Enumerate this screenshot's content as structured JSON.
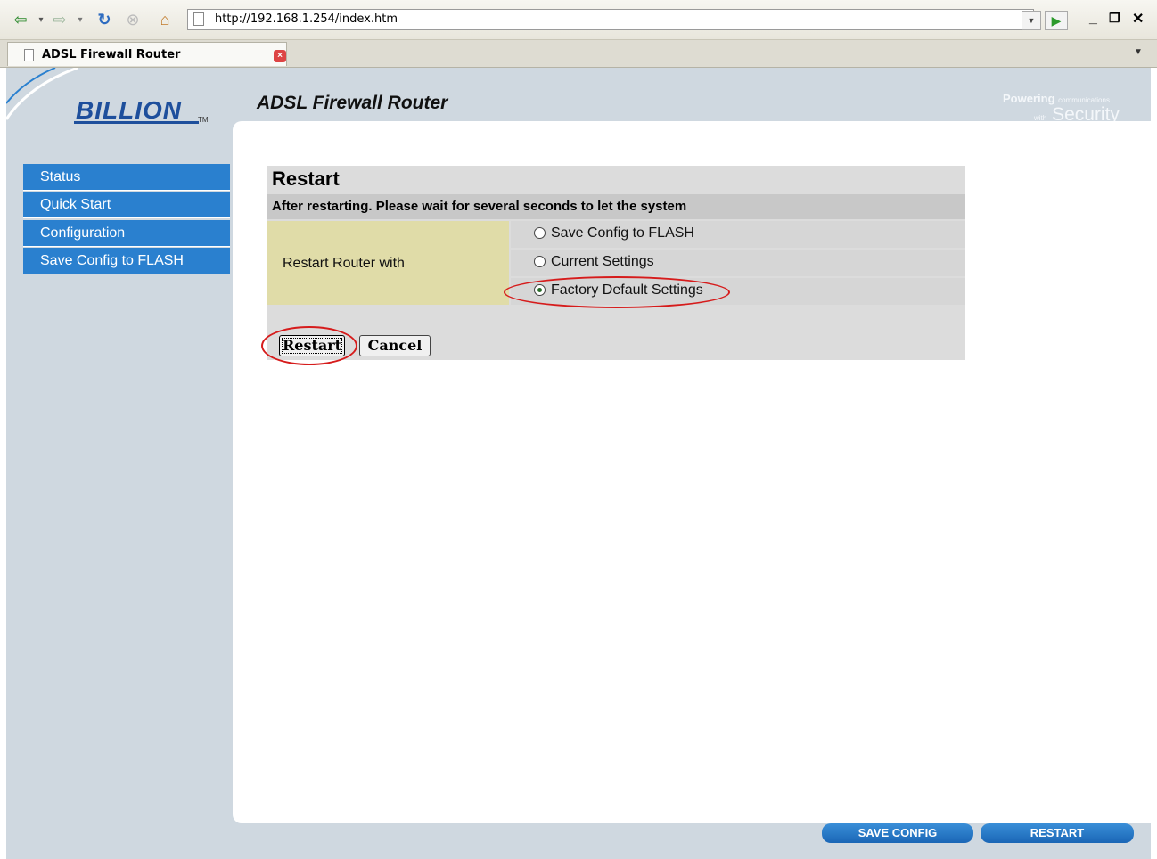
{
  "browser": {
    "url": "http://192.168.1.254/index.htm",
    "tab_title": "ADSL Firewall Router",
    "back_icon": "back-arrow-icon",
    "forward_icon": "forward-arrow-icon",
    "reload_icon": "reload-icon",
    "stop_icon": "stop-icon",
    "home_icon": "home-icon"
  },
  "header": {
    "logo": "BILLION",
    "logo_tm": "TM",
    "title": "ADSL Firewall Router",
    "slogan_big": "Powering",
    "slogan_small": "communications",
    "slogan_with": "with",
    "slogan_security": "Security"
  },
  "sidebar": {
    "items": [
      {
        "label": "Status"
      },
      {
        "label": "Quick Start"
      },
      {
        "label": "Configuration"
      },
      {
        "label": "Save Config to FLASH"
      }
    ]
  },
  "restart_panel": {
    "title": "Restart",
    "message": "After restarting. Please wait for several seconds to let the system",
    "row_label": "Restart Router with",
    "options": [
      {
        "label": "Save Config to FLASH",
        "checked": false
      },
      {
        "label": "Current Settings",
        "checked": false
      },
      {
        "label": "Factory Default Settings",
        "checked": true
      }
    ],
    "restart_label": "Restart",
    "cancel_label": "Cancel"
  },
  "footer": {
    "save_config_label": "SAVE CONFIG",
    "restart_label": "RESTART"
  },
  "colors": {
    "sidebar_blue": "#2a80cf",
    "annotation_red": "#d61c1c",
    "label_cell": "#e0dca8"
  }
}
